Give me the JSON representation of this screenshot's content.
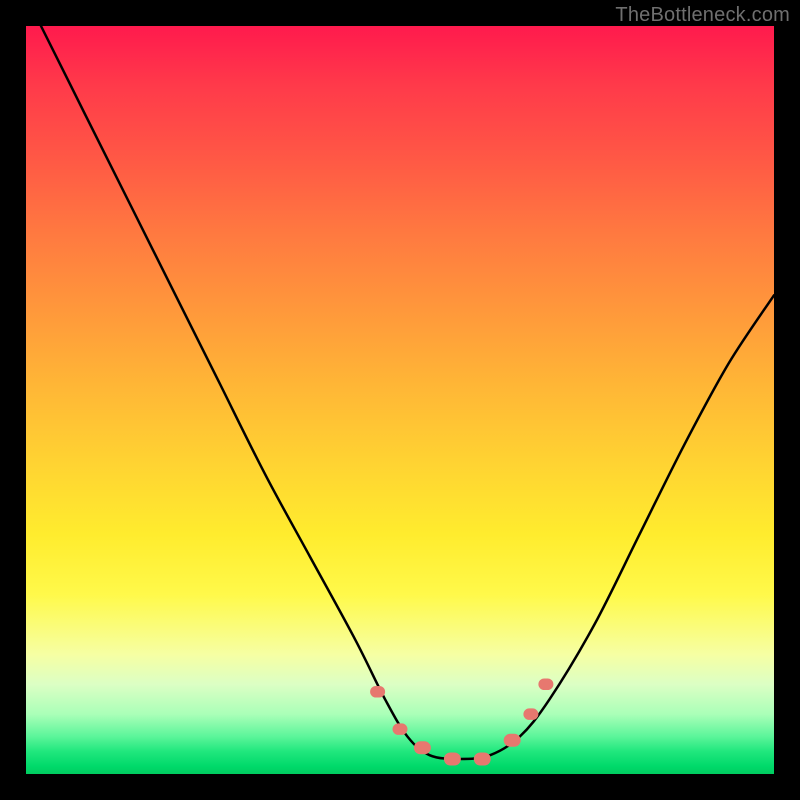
{
  "watermark": "TheBottleneck.com",
  "colors": {
    "frame": "#000000",
    "curve": "#000000",
    "beads": "#e7786f"
  },
  "chart_data": {
    "type": "line",
    "title": "",
    "xlabel": "",
    "ylabel": "",
    "xlim": [
      0,
      100
    ],
    "ylim": [
      0,
      100
    ],
    "grid": false,
    "note": "Axes are implicit (no tick labels shown). Values are read as percentages of plot width (x) and plot height (y, 0 at bottom). Curve is a V-shaped bottleneck profile.",
    "series": [
      {
        "name": "bottleneck-curve",
        "x": [
          2,
          8,
          14,
          20,
          26,
          32,
          38,
          44,
          48,
          51,
          54,
          58,
          62,
          66,
          70,
          76,
          82,
          88,
          94,
          100
        ],
        "y": [
          100,
          88,
          76,
          64,
          52,
          40,
          29,
          18,
          10,
          5,
          2.5,
          2,
          2.5,
          5,
          10,
          20,
          32,
          44,
          55,
          64
        ]
      }
    ],
    "markers": {
      "name": "curve-beads",
      "note": "Pink rounded beads drawn along the curve near the valley.",
      "x": [
        47,
        50,
        53,
        57,
        61,
        65,
        67.5,
        69.5
      ],
      "y": [
        11,
        6,
        3.5,
        2,
        2,
        4.5,
        8,
        12
      ]
    }
  }
}
